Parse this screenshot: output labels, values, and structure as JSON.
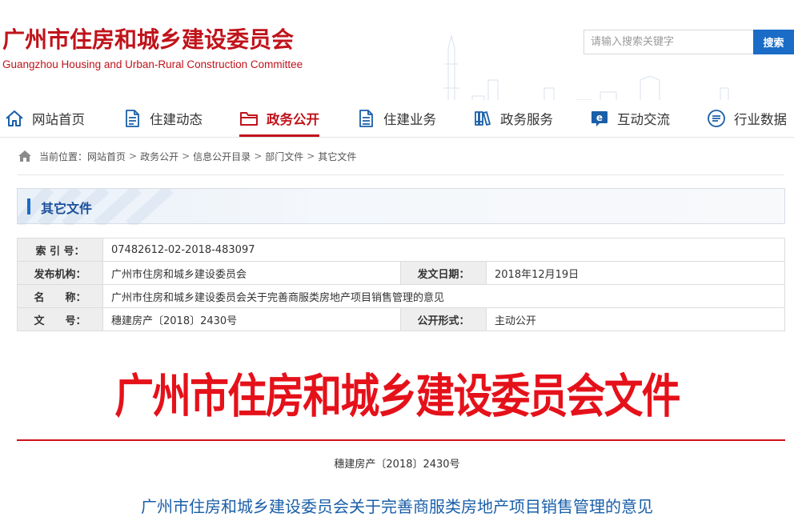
{
  "header": {
    "title_cn": "广州市住房和城乡建设委员会",
    "title_en": "Guangzhou Housing and Urban-Rural Construction Committee",
    "brand_color": "#c0131b"
  },
  "search": {
    "placeholder": "请输入搜索关键字",
    "button_label": "搜索"
  },
  "nav": {
    "items": [
      {
        "label": "网站首页",
        "icon": "home-icon"
      },
      {
        "label": "住建动态",
        "icon": "document-icon"
      },
      {
        "label": "政务公开",
        "icon": "folder-icon",
        "active": true
      },
      {
        "label": "住建业务",
        "icon": "document-list-icon"
      },
      {
        "label": "政务服务",
        "icon": "books-icon"
      },
      {
        "label": "互动交流",
        "icon": "e-chat-icon"
      },
      {
        "label": "行业数据",
        "icon": "list-circle-icon"
      }
    ]
  },
  "breadcrumb": {
    "prefix": "当前位置：",
    "items": [
      "网站首页",
      "政务公开",
      "信息公开目录",
      "部门文件",
      "其它文件"
    ],
    "separator": ">"
  },
  "section": {
    "title": "其它文件"
  },
  "meta": {
    "index_label": "索 引 号：",
    "index_value": "07482612-02-2018-483097",
    "issuer_label": "发布机构：",
    "issuer_value": "广州市住房和城乡建设委员会",
    "date_label": "发文日期：",
    "date_value": "2018年12月19日",
    "name_label": "名　　称：",
    "name_value": "广州市住房和城乡建设委员会关于完善商服类房地产项目销售管理的意见",
    "docno_label": "文　　号：",
    "docno_value": "穗建房产〔2018〕2430号",
    "publicity_label": "公开形式：",
    "publicity_value": "主动公开"
  },
  "document": {
    "masthead": "广州市住房和城乡建设委员会文件",
    "doc_number": "穗建房产〔2018〕2430号",
    "title": "广州市住房和城乡建设委员会关于完善商服类房地产项目销售管理的意见",
    "masthead_color": "#e5111a"
  }
}
